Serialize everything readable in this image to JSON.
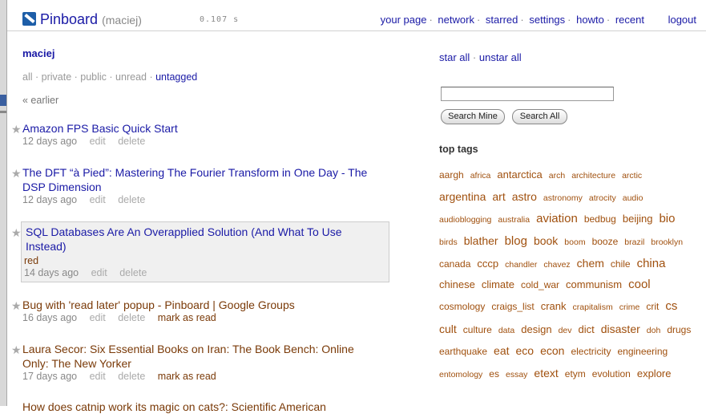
{
  "header": {
    "brand": "Pinboard",
    "user": "(maciej)",
    "timing": "0.107 s",
    "nav": [
      "your page",
      "network",
      "starred",
      "settings",
      "howto",
      "recent"
    ],
    "logout": "logout"
  },
  "profile": {
    "username": "maciej"
  },
  "filters": {
    "items": [
      "all",
      "private",
      "public",
      "unread",
      "untagged"
    ],
    "selected": "untagged"
  },
  "earlier": "« earlier",
  "bookmarks": [
    {
      "title": "Amazon FPS Basic Quick Start",
      "date": "12 days ago",
      "actions": [
        "edit",
        "delete"
      ],
      "unread": false
    },
    {
      "title_lines": [
        "The DFT “à Pied”: Mastering The Fourier Transform in One Day - The",
        "DSP Dimension"
      ],
      "date": "12 days ago",
      "actions": [
        "edit",
        "delete"
      ],
      "unread": false
    },
    {
      "title_lines": [
        "SQL Databases Are An Overapplied Solution (And What To Use",
        "Instead)"
      ],
      "tags": "red",
      "date": "14 days ago",
      "actions": [
        "edit",
        "delete"
      ],
      "unread": false,
      "highlighted": true
    },
    {
      "title": "Bug with 'read later' popup - Pinboard | Google Groups",
      "date": "16 days ago",
      "actions": [
        "edit",
        "delete"
      ],
      "mark": "mark as read",
      "unread": true
    },
    {
      "title_lines": [
        "Laura Secor: Six Essential Books on Iran: The Book Bench: Online",
        "Only: The New Yorker"
      ],
      "date": "17 days ago",
      "actions": [
        "edit",
        "delete"
      ],
      "mark": "mark as read",
      "unread": true
    },
    {
      "title": "How does catnip work its magic on cats?: Scientific American",
      "unread": true
    }
  ],
  "sidebar": {
    "star_all": "star all",
    "unstar_all": "unstar all",
    "search_mine": "Search Mine",
    "search_all": "Search All",
    "top_tags_heading": "top tags",
    "tag_rows": [
      [
        [
          "aargh",
          2
        ],
        [
          "africa",
          1
        ],
        [
          "antarctica",
          3
        ],
        [
          "arch",
          1
        ],
        [
          "architecture",
          1
        ],
        [
          "arctic",
          1
        ]
      ],
      [
        [
          "argentina",
          4
        ],
        [
          "art",
          4
        ],
        [
          "astro",
          4
        ],
        [
          "astronomy",
          1
        ],
        [
          "atrocity",
          1
        ],
        [
          "audio",
          1
        ]
      ],
      [
        [
          "audioblogging",
          1
        ],
        [
          "australia",
          1
        ],
        [
          "aviation",
          5
        ],
        [
          "bedbug",
          2
        ],
        [
          "beijing",
          3
        ],
        [
          "bio",
          5
        ]
      ],
      [
        [
          "birds",
          1
        ],
        [
          "blather",
          4
        ],
        [
          "blog",
          5
        ],
        [
          "book",
          4
        ],
        [
          "boom",
          1
        ],
        [
          "booze",
          2
        ],
        [
          "brazil",
          1
        ],
        [
          "brooklyn",
          1
        ]
      ],
      [
        [
          "canada",
          2
        ],
        [
          "cccp",
          3
        ],
        [
          "chandler",
          1
        ],
        [
          "chavez",
          1
        ],
        [
          "chem",
          4
        ],
        [
          "chile",
          2
        ],
        [
          "china",
          5
        ]
      ],
      [
        [
          "chinese",
          3
        ],
        [
          "climate",
          3
        ],
        [
          "cold_war",
          2
        ],
        [
          "communism",
          3
        ],
        [
          "cool",
          5
        ]
      ],
      [
        [
          "cosmology",
          2
        ],
        [
          "craigs_list",
          2
        ],
        [
          "crank",
          3
        ],
        [
          "crapitalism",
          1
        ],
        [
          "crime",
          1
        ],
        [
          "crit",
          2
        ],
        [
          "cs",
          5
        ]
      ],
      [
        [
          "cult",
          4
        ],
        [
          "culture",
          2
        ],
        [
          "data",
          1
        ],
        [
          "design",
          3
        ],
        [
          "dev",
          1
        ],
        [
          "dict",
          3
        ],
        [
          "disaster",
          4
        ],
        [
          "doh",
          1
        ],
        [
          "drugs",
          2
        ]
      ],
      [
        [
          "earthquake",
          2
        ],
        [
          "eat",
          4
        ],
        [
          "eco",
          4
        ],
        [
          "econ",
          4
        ],
        [
          "electricity",
          2
        ],
        [
          "engineering",
          2
        ]
      ],
      [
        [
          "entomology",
          1
        ],
        [
          "es",
          2
        ],
        [
          "essay",
          1
        ],
        [
          "etext",
          4
        ],
        [
          "etym",
          2
        ],
        [
          "evolution",
          2
        ],
        [
          "explore",
          3
        ]
      ]
    ]
  }
}
